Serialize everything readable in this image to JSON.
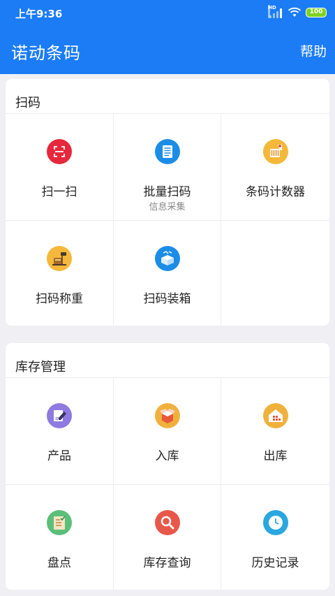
{
  "status": {
    "time": "上午9:36",
    "battery": "100",
    "network": "HD"
  },
  "header": {
    "title": "诺动条码",
    "help": "帮助"
  },
  "scan_section": {
    "title": "扫码",
    "items": [
      {
        "label": "扫一扫",
        "sub": "",
        "icon": "scan-icon",
        "color": "#e6283c"
      },
      {
        "label": "批量扫码",
        "sub": "信息采集",
        "icon": "batch-scan-icon",
        "color": "#1c8de6"
      },
      {
        "label": "条码计数器",
        "sub": "",
        "icon": "barcode-counter-icon",
        "color": "#f5b83a"
      },
      {
        "label": "扫码称重",
        "sub": "",
        "icon": "weighing-scale-icon",
        "color": "#f5b83a"
      },
      {
        "label": "扫码装箱",
        "sub": "",
        "icon": "packing-box-icon",
        "color": "#1c8de6"
      }
    ]
  },
  "inventory_section": {
    "title": "库存管理",
    "items": [
      {
        "label": "产品",
        "icon": "product-edit-icon",
        "color": "#8e7ae0"
      },
      {
        "label": "入库",
        "icon": "inbound-box-icon",
        "color": "#f0b13c"
      },
      {
        "label": "出库",
        "icon": "outbound-warehouse-icon",
        "color": "#f0b13c"
      },
      {
        "label": "盘点",
        "icon": "stocktake-checklist-icon",
        "color": "#5bbf7a"
      },
      {
        "label": "库存查询",
        "icon": "search-magnifier-icon",
        "color": "#e8584a"
      },
      {
        "label": "历史记录",
        "icon": "clock-icon",
        "color": "#29a7df"
      }
    ]
  }
}
